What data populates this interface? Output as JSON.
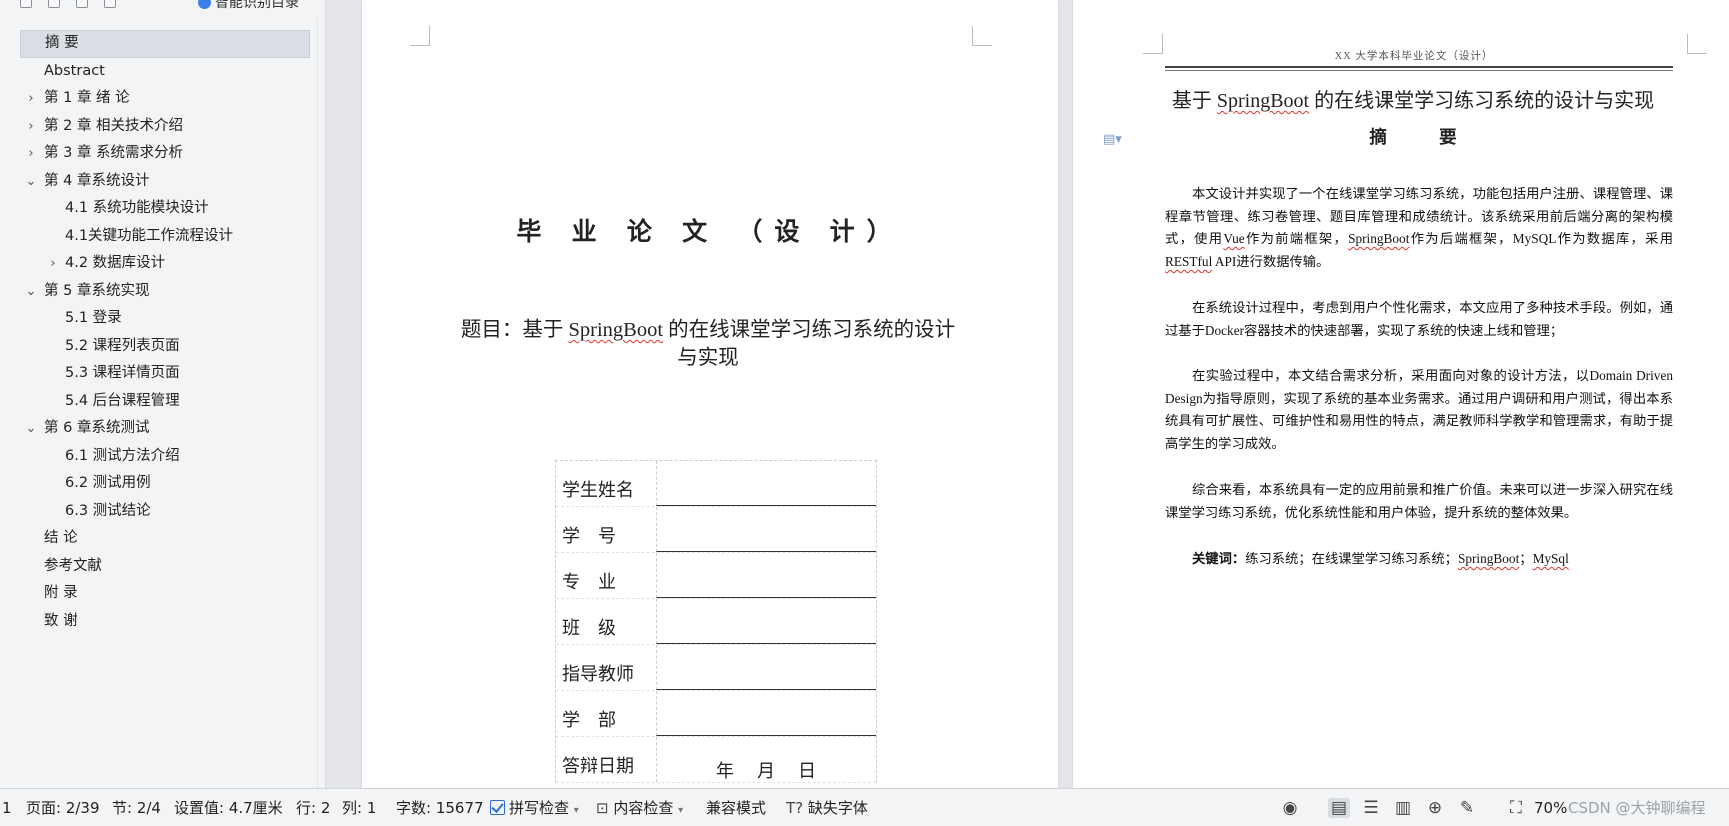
{
  "nav": {
    "smart_toc_label": "智能识别目录",
    "items": [
      {
        "label": "摘    要",
        "level": 1,
        "chevron": "",
        "selected": true
      },
      {
        "label": "Abstract",
        "level": 1,
        "chevron": ""
      },
      {
        "label": "第 1 章  绪      论",
        "level": 1,
        "chevron": "›"
      },
      {
        "label": "第 2 章  相关技术介绍",
        "level": 1,
        "chevron": "›"
      },
      {
        "label": "第 3 章  系统需求分析",
        "level": 1,
        "chevron": "›"
      },
      {
        "label": "第 4 章系统设计",
        "level": 1,
        "chevron": "⌄"
      },
      {
        "label": "4.1  系统功能模块设计",
        "level": 2,
        "chevron": ""
      },
      {
        "label": "4.1关键功能工作流程设计",
        "level": 2,
        "chevron": ""
      },
      {
        "label": "4.2  数据库设计",
        "level": 2,
        "chevron": "›"
      },
      {
        "label": "第 5 章系统实现",
        "level": 1,
        "chevron": "⌄"
      },
      {
        "label": "5.1  登录",
        "level": 2,
        "chevron": ""
      },
      {
        "label": "5.2  课程列表页面",
        "level": 2,
        "chevron": ""
      },
      {
        "label": "5.3  课程详情页面",
        "level": 2,
        "chevron": ""
      },
      {
        "label": "5.4  后台课程管理",
        "level": 2,
        "chevron": ""
      },
      {
        "label": "第 6 章系统测试",
        "level": 1,
        "chevron": "⌄"
      },
      {
        "label": "6.1  测试方法介绍",
        "level": 2,
        "chevron": ""
      },
      {
        "label": "6.2  测试用例",
        "level": 2,
        "chevron": ""
      },
      {
        "label": "6.3  测试结论",
        "level": 2,
        "chevron": ""
      },
      {
        "label": "结      论",
        "level": 1,
        "chevron": ""
      },
      {
        "label": "参考文献",
        "level": 1,
        "chevron": ""
      },
      {
        "label": "附      录",
        "level": 1,
        "chevron": ""
      },
      {
        "label": "致      谢",
        "level": 1,
        "chevron": ""
      }
    ]
  },
  "page1": {
    "title": "毕 业 论 文 （设 计）",
    "topic_prefix": "题目：基于 ",
    "topic_springboot": "SpringBoot",
    "topic_rest": " 的在线课堂学习练习系统的设计",
    "topic_line2": "与实现",
    "fields": [
      {
        "label": "学生姓名",
        "value": ""
      },
      {
        "label": "学    号",
        "value": ""
      },
      {
        "label": "专    业",
        "value": ""
      },
      {
        "label": "班    级",
        "value": ""
      },
      {
        "label": "指导教师",
        "value": ""
      },
      {
        "label": "学    部",
        "value": ""
      },
      {
        "label": "答辩日期",
        "value": "年    月    日"
      }
    ]
  },
  "page2": {
    "header": "XX 大学本科毕业论文（设计）",
    "title_prefix": "基于 ",
    "title_springboot": "SpringBoot",
    "title_rest": " 的在线课堂学习练习系统的设计与实现",
    "abstract_heading": "摘 要",
    "para1_a": "本文设计并实现了一个在线课堂学习练习系统，功能包括用户注册、课程管理、课程章节管理、练习卷管理、题目库管理和成绩统计。该系统采用前后端分离的架构模式，使用",
    "para1_vue": "Vue",
    "para1_b": "作为前端框架，",
    "para1_sb": "SpringBoot",
    "para1_c": "作为后端框架，MySQL作为数据库，采用",
    "para1_restful": "RESTful",
    "para1_d": " API进行数据传输。",
    "para2": "在系统设计过程中，考虑到用户个性化需求，本文应用了多种技术手段。例如，通过基于Docker容器技术的快速部署，实现了系统的快速上线和管理；",
    "para3": "在实验过程中，本文结合需求分析，采用面向对象的设计方法，以Domain Driven Design为指导原则，实现了系统的基本业务需求。通过用户调研和用户测试，得出本系统具有可扩展性、可维护性和易用性的特点，满足教师科学教学和管理需求，有助于提高学生的学习成效。",
    "para4": "综合来看，本系统具有一定的应用前景和推广价值。未来可以进一步深入研究在线课堂学习练习系统，优化系统性能和用户体验，提升系统的整体效果。",
    "keywords_label": "关键词：",
    "keywords_a": "练习系统；在线课堂学习练习系统；",
    "keywords_sb": "SpringBoot",
    "keywords_sep": "；",
    "keywords_mysql": "MySql"
  },
  "status": {
    "page_index": "1",
    "page": "页面: 2/39",
    "section": "节: 2/4",
    "setting": "设置值: 4.7厘米",
    "row": "行: 2",
    "col": "列: 1",
    "wordcount": "字数: 15677",
    "spellcheck": "拼写检查",
    "contentcheck": "内容检查",
    "compat": "兼容模式",
    "missing_font": "缺失字体",
    "zoom": "70%",
    "watermark": "CSDN @大钟聊编程"
  }
}
